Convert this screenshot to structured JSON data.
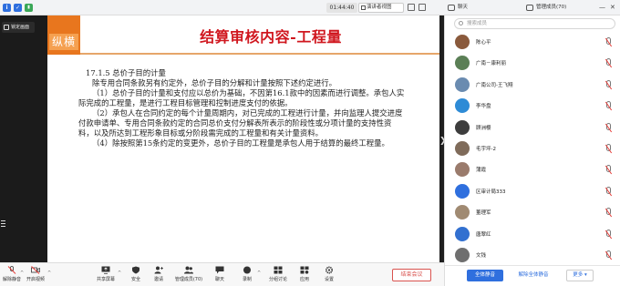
{
  "topbar": {
    "timer": "01:44:40",
    "view_button": "演讲者视图",
    "chat_tab": "聊天",
    "members_tab": "管理成员(70)"
  },
  "left": {
    "follow_label": "锁定画面"
  },
  "slide": {
    "logo_text": "纵横",
    "title": "结算审核内容-工程量",
    "section": "17.1.5 总价子目的计量",
    "paragraphs": [
      "除专用合同条款另有约定外，总价子目的分解和计量按照下述约定进行。",
      "（1）总价子目的计量和支付应以总价为基础，不因第16.1款中的因素而进行调整。承包人实际完成的工程量，是进行工程目标管理和控制进度支付的依据。",
      "（2）承包人在合同约定的每个计量周期内，对已完成的工程进行计量，并向监理人提交进度付款申请单、专用合同条款约定的合同总价支付分解表所表示的阶段性或分项计量的支持性资料，以及所达到工程形象目标或分阶段需完成的工程量和有关计量资料。",
      "（4）除按照第15条约定的变更外，总价子目的工程量是承包人用于结算的最终工程量。"
    ]
  },
  "toolbar": {
    "mute": "解除静音",
    "video": "开启视频",
    "share": "共享屏幕",
    "security": "安全",
    "invite": "邀请",
    "manage": "管理成员(70)",
    "chat": "聊天",
    "record": "录制",
    "breakout": "分组讨论",
    "apps": "应用",
    "settings": "设置",
    "end": "结束会议"
  },
  "panel": {
    "search_placeholder": "搜索成员",
    "members": [
      {
        "name": "陈心平",
        "color": "#8a5a3c"
      },
      {
        "name": "广南－康利丽",
        "color": "#5b7f56"
      },
      {
        "name": "广南公司-王飞翔",
        "color": "#6a8bb0"
      },
      {
        "name": "李华盘",
        "color": "#2e8bd6"
      },
      {
        "name": "顾洲樱",
        "color": "#3d3d3d"
      },
      {
        "name": "毛宇坪-2",
        "color": "#7f6b5a"
      },
      {
        "name": "蒲霞",
        "color": "#9a7b6c"
      },
      {
        "name": "区审计局333",
        "color": "#2f6fde"
      },
      {
        "name": "董理军",
        "color": "#a08a72"
      },
      {
        "name": "唐翠红",
        "color": "#3270d0"
      },
      {
        "name": "文钱",
        "color": "#6f6f6f"
      }
    ],
    "mute_all": "全体静音",
    "unmute_all": "解除全体静音",
    "more": "更多 ▾"
  }
}
